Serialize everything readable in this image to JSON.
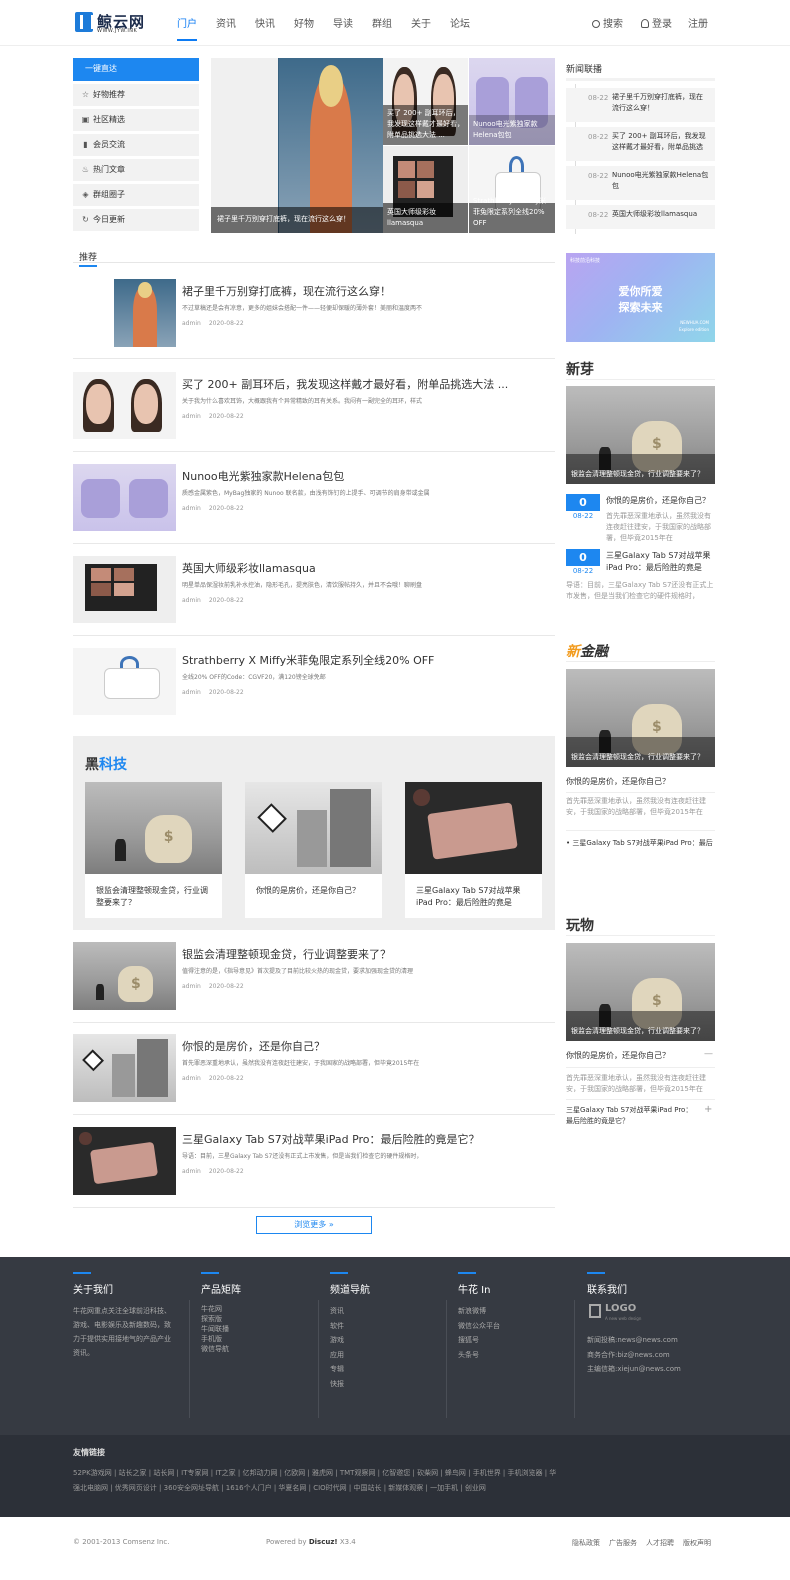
{
  "header": {
    "logo_name": "鲸云网",
    "logo_url": "WWW.JYW.INK",
    "nav": [
      "门户",
      "资讯",
      "快讯",
      "好物",
      "导读",
      "群组",
      "关于",
      "论坛"
    ],
    "search": "搜索",
    "login": "登录",
    "register": "注册"
  },
  "menu": [
    "一键直达",
    "好物推荐",
    "社区精选",
    "会员交流",
    "热门文章",
    "群组圈子",
    "今日更新"
  ],
  "slider": {
    "main_caption": "裙子里千万别穿打底裤，现在流行这么穿！",
    "t1": "买了 200+ 副耳环后，我发现这样戴才最好看，附单品挑选大法 ...",
    "t2": "Nunoo电光紫独家款Helena包包",
    "t3": "英国大师级彩妆llamasqua",
    "t4": "Strathberry X Miffy米菲兔限定系列全线20% OFF"
  },
  "news_flash": {
    "title": "新闻联播",
    "items": [
      {
        "date": "08-22",
        "text": "裙子里千万别穿打底裤，现在流行这么穿！"
      },
      {
        "date": "08-22",
        "text": "买了 200+ 副耳环后，我发现这样戴才最好看，附单品挑选大 ..."
      },
      {
        "date": "08-22",
        "text": "Nunoo电光紫独家款Helena包包"
      },
      {
        "date": "08-22",
        "text": "英国大师级彩妆llamasqua"
      }
    ]
  },
  "ad": {
    "small": "科技前沿科技",
    "line1": "爱你所爱",
    "line2": "探索未来",
    "brand": "NEWHUA.COM",
    "sub": "Explore edition"
  },
  "recommend_tab": "推荐",
  "articles": [
    {
      "title": "裙子里千万别穿打底裤，现在流行这么穿！",
      "desc": "不过草稿还是会有凉意，更多的姐妹会搭配一件——轻便却保暖的薄外套！美丽和温度两不",
      "author": "admin",
      "date": "2020-08-22"
    },
    {
      "title": "买了 200+ 副耳环后，我发现这样戴才最好看，附单品挑选大法 ...",
      "desc": "关于我为什么喜欢耳饰，大概跟我有个异常精致的耳有关系。我闷有一副完全的耳环，样式",
      "author": "admin",
      "date": "2020-08-22"
    },
    {
      "title": "Nunoo电光紫独家款Helena包包",
      "desc": "质感金属紫色，MyBag独家的 Nunoo 联名款，由浅有饰钉的上提手、可调节的肩身带或金属",
      "author": "admin",
      "date": "2020-08-22"
    },
    {
      "title": "英国大师级彩妆llamasqua",
      "desc": "明星单品保湿妆前乳补水控油，隐形毛孔，提亮肤色，清饮服帖持久，并且不会哦！聊刷盘",
      "author": "admin",
      "date": "2020-08-22"
    },
    {
      "title": "Strathberry X Miffy米菲兔限定系列全线20% OFF",
      "desc": "全线20% OFF的Code：CGVF20，满120镑全球免邮",
      "author": "admin",
      "date": "2020-08-22"
    }
  ],
  "black_tech": {
    "title_a": "黑",
    "title_b": "科技",
    "cards": [
      "银监会清理整顿现金贷，行业调整要来了？",
      "你恨的是房价，还是你自己？",
      "三星Galaxy Tab S7对战苹果iPad Pro：最后险胜的竟是"
    ]
  },
  "articles2": [
    {
      "title": "银监会清理整顿现金贷，行业调整要来了？",
      "desc": "值得注意的是，《指导意见》首次提及了目前比较火热的现金贷，要求加强现金贷的清理",
      "author": "admin",
      "date": "2020-08-22"
    },
    {
      "title": "你恨的是房价，还是你自己？",
      "desc": "首先罪恶深重地承认，虽然我没有连夜赶往建安，于我国家的战略部署，但毕竟2015年在",
      "author": "admin",
      "date": "2020-08-22"
    },
    {
      "title": "三星Galaxy Tab S7对战苹果iPad Pro：最后险胜的竟是它？",
      "desc": "导语：目前，三星Galaxy Tab S7还没有正式上市发售，但是当我们检查它的硬件规格时，",
      "author": "admin",
      "date": "2020-08-22"
    }
  ],
  "more_button": "浏览更多 »",
  "xinya": {
    "title": "新芽",
    "img_caption": "银监会清理整顿现金贷，行业调整要来了？",
    "items": [
      {
        "day": "0",
        "month": "08-22",
        "title": "你恨的是房价，还是你自己？",
        "desc": "首先罪恶深重地承认，虽然我没有连夜赶往建安，于我国家的战略部署，但毕竟2015年在"
      },
      {
        "day": "0",
        "month": "08-22",
        "title": "三星Galaxy Tab S7对战苹果iPad Pro：最后险胜的竟是",
        "desc": "导语：目前，三星Galaxy Tab S7还没有正式上市发售，但是当我们检查它的硬件规格时，"
      }
    ]
  },
  "finance": {
    "title_a": "新",
    "title_b": "金融",
    "img_caption": "银监会清理整顿现金贷，行业调整要来了？",
    "item1_title": "你恨的是房价，还是你自己？",
    "item1_desc": "首先罪恶深重地承认，虽然我没有连夜赶往建安，于我国家的战略部署，但毕竟2015年在",
    "item2_title": "• 三星Galaxy Tab S7对战苹果iPad Pro：最后"
  },
  "wanwu": {
    "title": "玩物",
    "img_caption": "银监会清理整顿现金贷，行业调整要来了？",
    "item1_title": "你恨的是房价，还是你自己？",
    "item1_sym": "—",
    "item1_desc": "首先罪恶深重地承认，虽然我没有连夜赶往建安，于我国家的战略部署，但毕竟2015年在",
    "item2_title": "三星Galaxy Tab S7对战苹果iPad Pro：最后险胜的竟是它？",
    "item2_sym": "+"
  },
  "footer": {
    "about_title": "关于我们",
    "about_text": "牛花网重点关注全球前沿科技、游戏、电影娱乐及新趣数码，致力于提供实用接地气的产品产业资讯。",
    "products_title": "产品矩阵",
    "products": [
      "牛花网",
      "探索版",
      "牛闻联播",
      "手机版",
      "微信导航"
    ],
    "channels_title": "频道导航",
    "channels": [
      "资讯",
      "软件",
      "游戏",
      "应用",
      "专辑",
      "快报"
    ],
    "niuhua_title": "牛花 In",
    "niuhua": [
      "新浪微博",
      "微信公众平台",
      "搜狐号",
      "头条号"
    ],
    "contact_title": "联系我们",
    "contact_logo": "LOGO",
    "contact_logo_sub": "A new web design",
    "contacts": [
      "新闻投稿:news@news.com",
      "商务合作:biz@news.com",
      "主编信箱:xiejun@news.com"
    ]
  },
  "friends": {
    "title": "友情链接",
    "row1": "52PK游戏网 | 站长之家 | 站长网 | IT专家网 | IT之家 | 亿邦动力网 | 亿欧网 | 雅虎网 | TMT观察网 | 亿智邀您 | 砍柴网 | 蜂鸟网 | 手机世界 | 手机浏览器 | 华",
    "row2": "强北电脑网 | 优秀网页设计 | 360安全网址导航 | 1616个人门户 | 华夏名网 | CIO时代网 | 中国站长 | 新媒体观察 | 一加手机 | 创业网"
  },
  "bottom": {
    "copyright": "© 2001-2013 Comsenz Inc.",
    "powered_prefix": "Powered by",
    "powered_name": "Discuz!",
    "powered_ver": "X3.4",
    "links": [
      "隐私政策",
      "广告服务",
      "人才招聘",
      "版权声明"
    ]
  }
}
